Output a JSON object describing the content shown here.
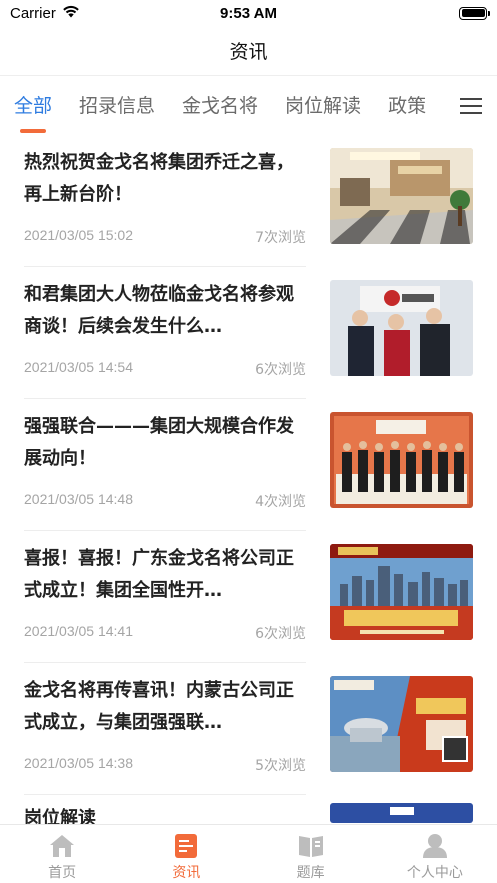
{
  "status_bar": {
    "carrier": "Carrier",
    "time": "9:53 AM"
  },
  "nav": {
    "title": "资讯"
  },
  "tabs": [
    {
      "label": "全部",
      "active": true
    },
    {
      "label": "招录信息",
      "active": false
    },
    {
      "label": "金戈名将",
      "active": false
    },
    {
      "label": "岗位解读",
      "active": false
    },
    {
      "label": "政策",
      "active": false
    }
  ],
  "articles": [
    {
      "title": "热烈祝贺金戈名将集团乔迁之喜，再上新台阶！",
      "date": "2021/03/05 15:02",
      "views": "7次浏览"
    },
    {
      "title": "和君集团大人物莅临金戈名将参观商谈！后续会发生什么…",
      "date": "2021/03/05 14:54",
      "views": "6次浏览"
    },
    {
      "title": "强强联合———集团大规模合作发展动向！",
      "date": "2021/03/05 14:48",
      "views": "4次浏览"
    },
    {
      "title": "喜报！喜报！广东金戈名将公司正式成立！集团全国性开…",
      "date": "2021/03/05 14:41",
      "views": "6次浏览"
    },
    {
      "title": "金戈名将再传喜讯！内蒙古公司正式成立，与集团强强联…",
      "date": "2021/03/05 14:38",
      "views": "5次浏览"
    }
  ],
  "partial_article": {
    "title": "岗位解读"
  },
  "tabbar": [
    {
      "label": "首页",
      "icon": "home-icon",
      "active": false
    },
    {
      "label": "资讯",
      "icon": "news-icon",
      "active": true
    },
    {
      "label": "题库",
      "icon": "book-icon",
      "active": false
    },
    {
      "label": "个人中心",
      "icon": "person-icon",
      "active": false
    }
  ],
  "colors": {
    "accent_blue": "#2f7ce0",
    "accent_orange": "#f26b3a",
    "muted": "#a5a5a5"
  }
}
